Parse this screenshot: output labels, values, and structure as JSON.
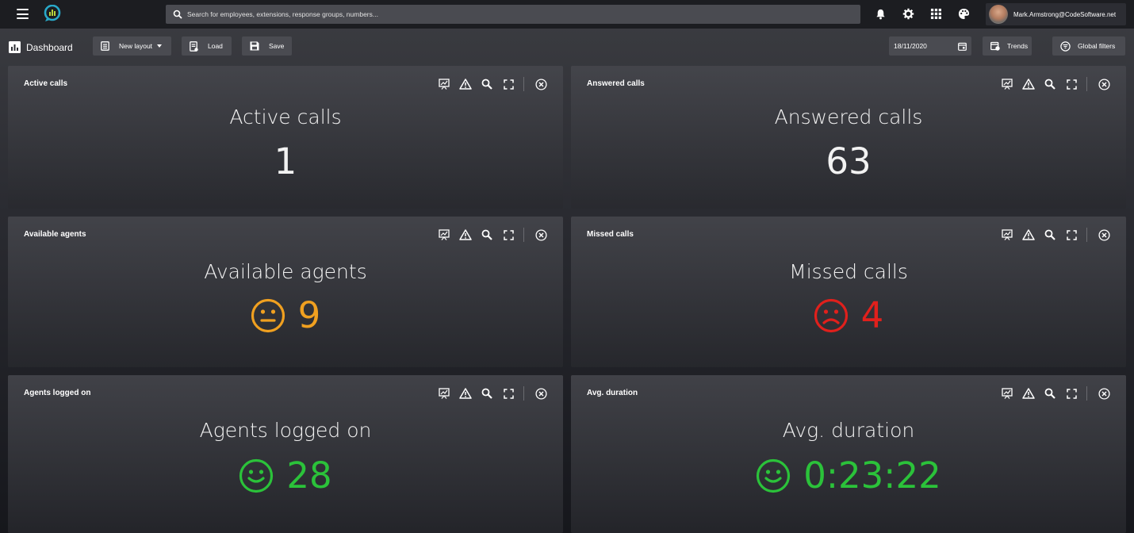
{
  "search": {
    "placeholder": "Search for employees, extensions, response groups, numbers..."
  },
  "user": {
    "email": "Mark.Armstrong@CodeSoftware.net"
  },
  "toolbar": {
    "title": "Dashboard",
    "new_layout_label": "New layout",
    "load_label": "Load",
    "save_label": "Save",
    "date_value": "18/11/2020",
    "trends_label": "Trends",
    "global_filters_label": "Global filters"
  },
  "colors": {
    "accent": "#29a9c9",
    "neutral": "#f0a020",
    "bad": "#e0201c",
    "good": "#2bc23a"
  },
  "widgets": [
    {
      "header": "Active calls",
      "title": "Active calls",
      "value": "1",
      "mood": "none",
      "color": "#f2f2f2"
    },
    {
      "header": "Answered calls",
      "title": "Answered calls",
      "value": "63",
      "mood": "none",
      "color": "#f2f2f2"
    },
    {
      "header": "Available agents",
      "title": "Available agents",
      "value": "9",
      "mood": "neutral",
      "color": "#f0a020"
    },
    {
      "header": "Missed calls",
      "title": "Missed calls",
      "value": "4",
      "mood": "sad",
      "color": "#e0201c"
    },
    {
      "header": "Agents logged on",
      "title": "Agents logged on",
      "value": "28",
      "mood": "happy",
      "color": "#2bc23a"
    },
    {
      "header": "Avg. duration",
      "title": "Avg. duration",
      "value": "0:23:22",
      "mood": "happy",
      "color": "#2bc23a"
    }
  ]
}
